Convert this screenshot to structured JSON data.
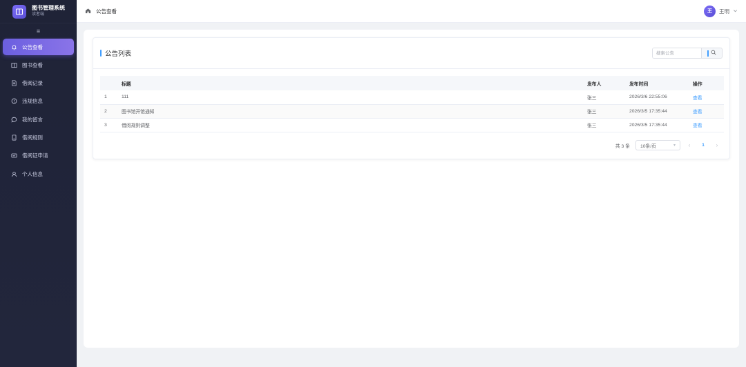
{
  "brand": {
    "title": "图书管理系统",
    "subtitle": "读者端"
  },
  "sidebar": {
    "collapse_icon": "≡",
    "items": [
      {
        "label": "公告查看",
        "icon": "bell-icon",
        "active": true
      },
      {
        "label": "图书查看",
        "icon": "book-icon",
        "active": false
      },
      {
        "label": "借阅记录",
        "icon": "document-icon",
        "active": false
      },
      {
        "label": "违规信息",
        "icon": "warning-circle-icon",
        "active": false
      },
      {
        "label": "我的留言",
        "icon": "message-icon",
        "active": false
      },
      {
        "label": "借阅规则",
        "icon": "notebook-icon",
        "active": false
      },
      {
        "label": "借阅证申请",
        "icon": "card-icon",
        "active": false
      },
      {
        "label": "个人信息",
        "icon": "user-icon",
        "active": false
      }
    ]
  },
  "header": {
    "breadcrumb": "公告查看",
    "user": {
      "avatar_text": "王",
      "name": "王明"
    }
  },
  "card": {
    "title": "公告列表",
    "search": {
      "placeholder": "搜索公告"
    }
  },
  "table": {
    "columns": {
      "title": "标题",
      "publisher": "发布人",
      "time": "发布时间",
      "action": "操作"
    },
    "rows": [
      {
        "index": "1",
        "title": "111",
        "publisher": "张三",
        "time": "2026/3/6 22:55:06",
        "action": "查看"
      },
      {
        "index": "2",
        "title": "图书馆开馆通知",
        "publisher": "张三",
        "time": "2026/3/5 17:35:44",
        "action": "查看"
      },
      {
        "index": "3",
        "title": "借阅规则调整",
        "publisher": "张三",
        "time": "2026/3/5 17:35:44",
        "action": "查看"
      }
    ]
  },
  "pagination": {
    "total_text": "共 3 条",
    "page_size": "10条/页",
    "current_page": "1"
  },
  "colors": {
    "sidebar_bg": "#1f2337",
    "active_accent": "#6b5fe0",
    "link": "#409eff"
  }
}
